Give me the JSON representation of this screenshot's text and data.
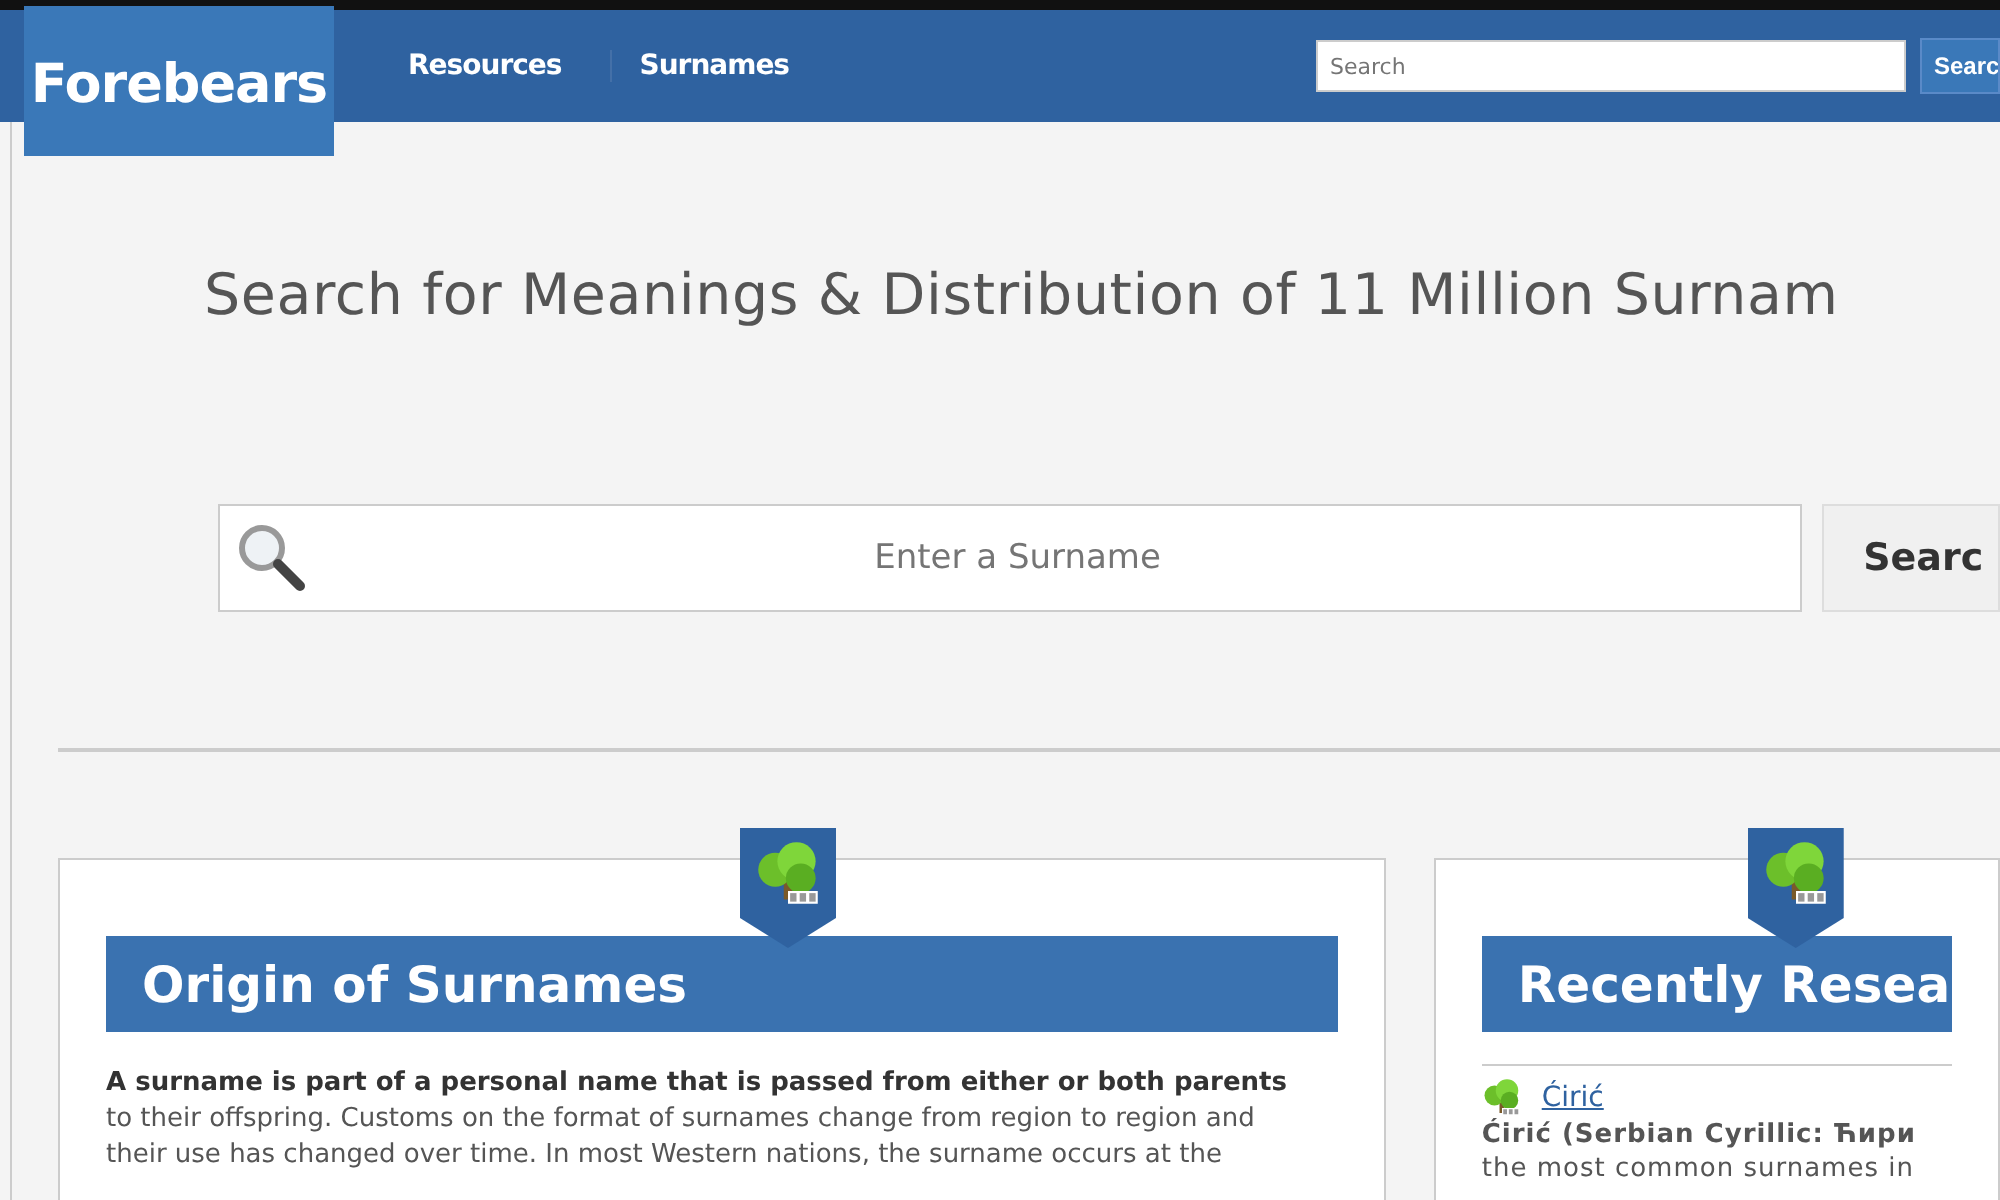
{
  "header": {
    "logo": "Forebears",
    "nav": [
      {
        "label": "Resources"
      },
      {
        "label": "Surnames"
      }
    ],
    "search": {
      "placeholder": "Search"
    },
    "search_button": "Searc"
  },
  "headline": "Search for Meanings & Distribution of 11 Million Surnam",
  "surname_search": {
    "placeholder": "Enter a Surname",
    "button": "Searc"
  },
  "cards": [
    {
      "title": "Origin of Surnames",
      "paragraph": [
        "**A surname is part of a personal name that is passed from either or both parents**",
        "to their offspring. Customs on the format of surnames change from region to region and",
        "their use has changed over time. In most Western nations, the surname occurs at the"
      ]
    },
    {
      "title": "Recently Resea",
      "entries": [
        {
          "link": "Ćirić",
          "lines": [
            "**Ćirić (Serbian Cyrillic: Ћири**",
            "the most common surnames in"
          ]
        }
      ]
    }
  ]
}
